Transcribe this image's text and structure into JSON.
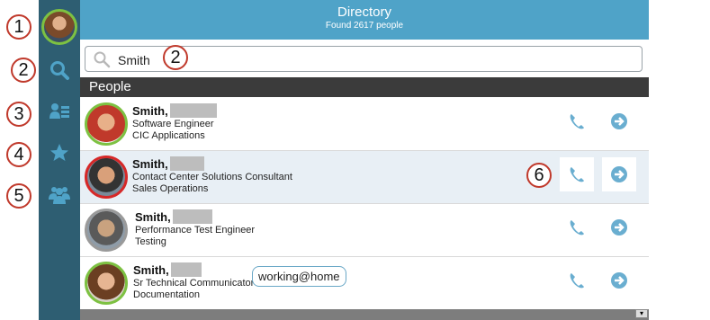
{
  "header": {
    "title": "Directory",
    "subtitle": "Found 2617 people"
  },
  "search": {
    "value": "Smith",
    "placeholder": ""
  },
  "section": {
    "label": "People"
  },
  "callouts": [
    "1",
    "2",
    "2",
    "3",
    "4",
    "5",
    "6"
  ],
  "sidebar": {
    "items": [
      {
        "icon": "user-avatar"
      },
      {
        "icon": "search-icon"
      },
      {
        "icon": "contact-list-icon"
      },
      {
        "icon": "star-icon"
      },
      {
        "icon": "group-icon"
      }
    ]
  },
  "people": [
    {
      "name": "Smith,",
      "title": "Software Engineer",
      "department": "CIC Applications",
      "status_color": "#7dc142"
    },
    {
      "name": "Smith,",
      "title": "Contact Center Solutions Consultant",
      "department": "Sales Operations",
      "status_color": "#d62828"
    },
    {
      "name": "Smith,",
      "title": "Performance Test Engineer",
      "department": "Testing",
      "status_color": "#9a9a9a"
    },
    {
      "name": "Smith,",
      "title": "Sr Technical Communicator",
      "department": "Documentation",
      "status_color": "#7dc142",
      "status_message": "working@home"
    }
  ],
  "colors": {
    "accent": "#4fa3c8",
    "sidebar": "#2e5e72",
    "available": "#7dc142",
    "busy": "#d62828",
    "away": "#9a9a9a"
  }
}
